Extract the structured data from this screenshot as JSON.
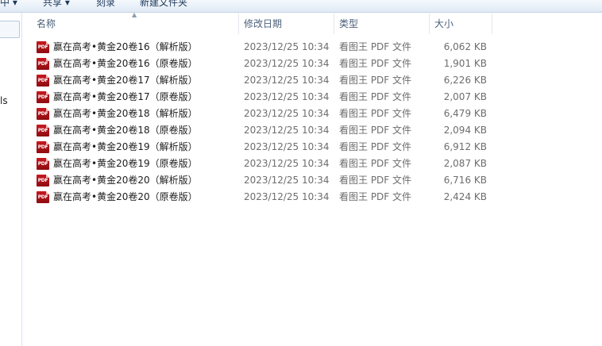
{
  "toolbar": {
    "items": [
      "中 ▾",
      "共享 ▾",
      "刻录",
      "新建文件夹"
    ]
  },
  "nav": {
    "partial_text": "ls"
  },
  "columns": {
    "name": "名称",
    "date": "修改日期",
    "type": "类型",
    "size": "大小"
  },
  "files": [
    {
      "name": "赢在高考•黄金20卷16（解析版）",
      "date": "2023/12/25 10:34",
      "type": "看图王 PDF 文件",
      "size": "6,062 KB"
    },
    {
      "name": "赢在高考•黄金20卷16（原卷版）",
      "date": "2023/12/25 10:34",
      "type": "看图王 PDF 文件",
      "size": "1,901 KB"
    },
    {
      "name": "赢在高考•黄金20卷17（解析版）",
      "date": "2023/12/25 10:34",
      "type": "看图王 PDF 文件",
      "size": "6,226 KB"
    },
    {
      "name": "赢在高考•黄金20卷17（原卷版）",
      "date": "2023/12/25 10:34",
      "type": "看图王 PDF 文件",
      "size": "2,007 KB"
    },
    {
      "name": "赢在高考•黄金20卷18（解析版）",
      "date": "2023/12/25 10:34",
      "type": "看图王 PDF 文件",
      "size": "6,479 KB"
    },
    {
      "name": "赢在高考•黄金20卷18（原卷版）",
      "date": "2023/12/25 10:34",
      "type": "看图王 PDF 文件",
      "size": "2,094 KB"
    },
    {
      "name": "赢在高考•黄金20卷19（解析版）",
      "date": "2023/12/25 10:34",
      "type": "看图王 PDF 文件",
      "size": "6,912 KB"
    },
    {
      "name": "赢在高考•黄金20卷19（原卷版）",
      "date": "2023/12/25 10:34",
      "type": "看图王 PDF 文件",
      "size": "2,087 KB"
    },
    {
      "name": "赢在高考•黄金20卷20（解析版）",
      "date": "2023/12/25 10:34",
      "type": "看图王 PDF 文件",
      "size": "6,716 KB"
    },
    {
      "name": "赢在高考•黄金20卷20（原卷版）",
      "date": "2023/12/25 10:34",
      "type": "看图王 PDF 文件",
      "size": "2,424 KB"
    }
  ],
  "icons": {
    "file": "pdf-file-icon",
    "file_label": "PDF",
    "sort": "sort-up-arrow-icon"
  },
  "colors": {
    "pdf_icon": "#b5141a",
    "header_text": "#4c607a",
    "meta_text": "#6d6d6d"
  }
}
